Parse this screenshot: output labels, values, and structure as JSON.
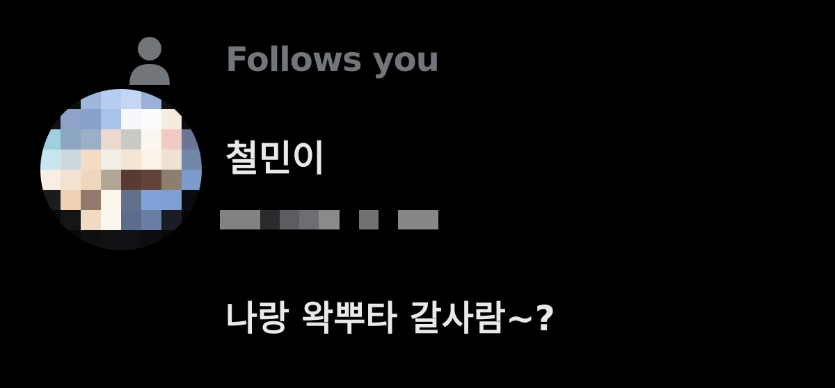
{
  "social_context": {
    "text": "Follows you",
    "icon": "person-icon",
    "color": "#71767b"
  },
  "user": {
    "display_name": "철민이",
    "handle_redacted": true,
    "avatar_pixelated": true
  },
  "post": {
    "text": "나랑 왁뿌타 갈사람~?"
  },
  "colors": {
    "background": "#000000",
    "primary_text": "#e7e9ea",
    "secondary_text": "#71767b"
  }
}
